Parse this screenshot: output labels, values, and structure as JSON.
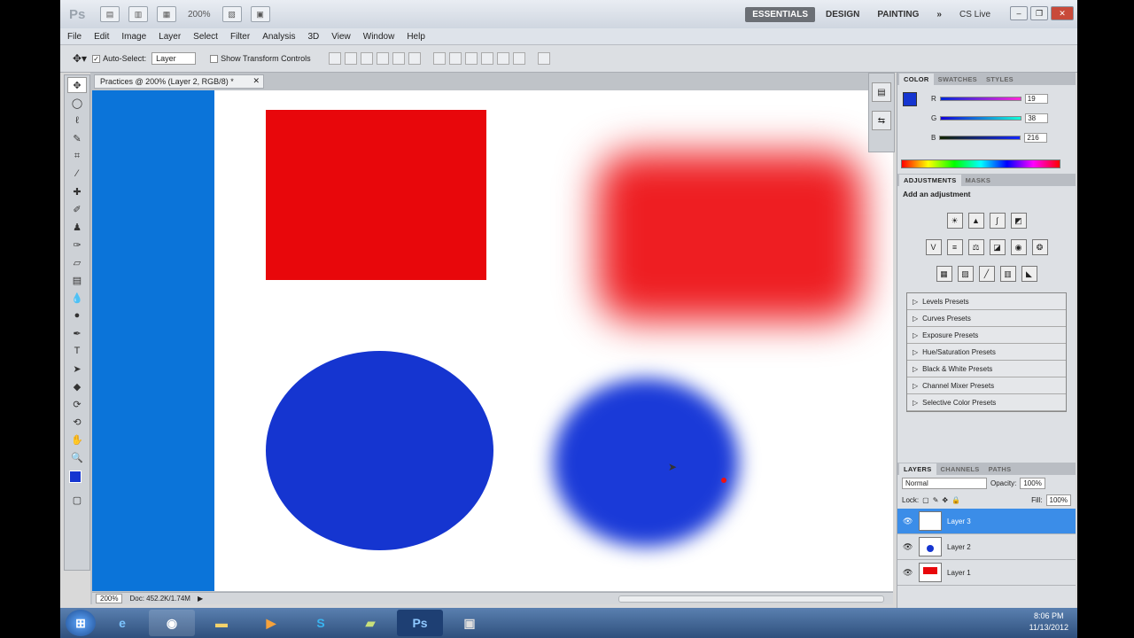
{
  "titlebar": {
    "app_icon": "Ps",
    "zoom": "200%",
    "workspaces": [
      "ESSENTIALS",
      "DESIGN",
      "PAINTING"
    ],
    "more": "»",
    "cslive": "CS Live"
  },
  "menu": [
    "File",
    "Edit",
    "Image",
    "Layer",
    "Select",
    "Filter",
    "Analysis",
    "3D",
    "View",
    "Window",
    "Help"
  ],
  "options": {
    "auto_select_label": "Auto-Select:",
    "auto_select_value": "Layer",
    "transform_label": "Show Transform Controls"
  },
  "document": {
    "tab_title": "Practices @ 200% (Layer 2, RGB/8) *",
    "status_zoom": "200%",
    "status_doc": "Doc: 452.2K/1.74M"
  },
  "color_panel": {
    "tabs": [
      "COLOR",
      "SWATCHES",
      "STYLES"
    ],
    "r_label": "R",
    "r_value": "19",
    "g_label": "G",
    "g_value": "38",
    "b_label": "B",
    "b_value": "216",
    "fg_color": "#1326d8"
  },
  "adjustments": {
    "tabs": [
      "ADJUSTMENTS",
      "MASKS"
    ],
    "title": "Add an adjustment",
    "presets": [
      "Levels Presets",
      "Curves Presets",
      "Exposure Presets",
      "Hue/Saturation Presets",
      "Black & White Presets",
      "Channel Mixer Presets",
      "Selective Color Presets"
    ]
  },
  "layers": {
    "tabs": [
      "LAYERS",
      "CHANNELS",
      "PATHS"
    ],
    "blend_mode": "Normal",
    "opacity_label": "Opacity:",
    "opacity_value": "100%",
    "lock_label": "Lock:",
    "fill_label": "Fill:",
    "fill_value": "100%",
    "items": [
      "Layer 3",
      "Layer 2",
      "Layer 1"
    ]
  },
  "taskbar": {
    "time": "8:06 PM",
    "date": "11/13/2012"
  }
}
